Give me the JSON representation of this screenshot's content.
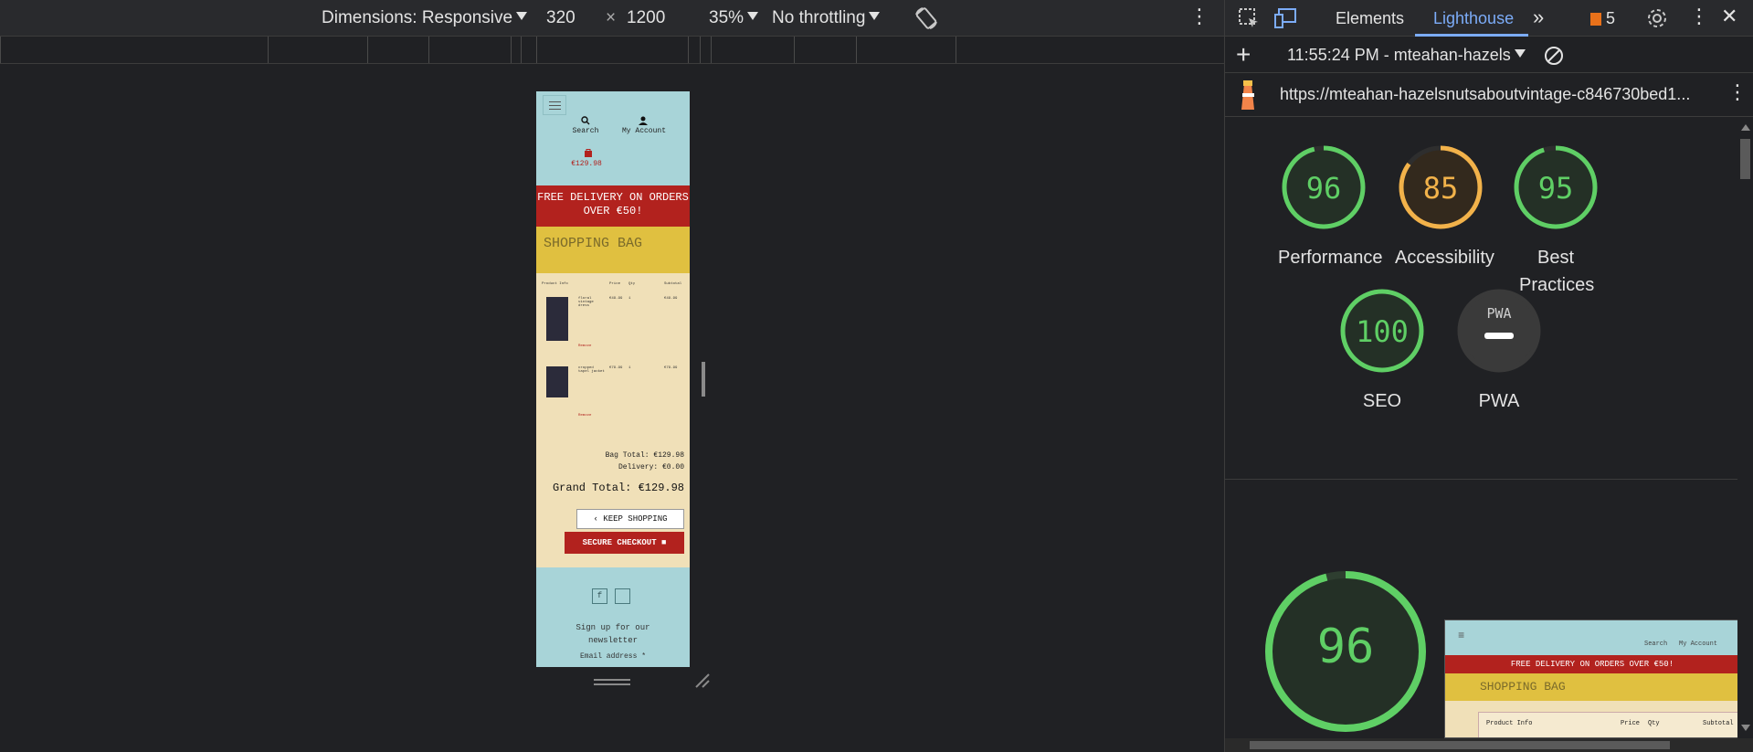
{
  "device_toolbar": {
    "dimensions_label": "Dimensions: Responsive",
    "width": "320",
    "times": "×",
    "height": "1200",
    "zoom": "35%",
    "throttling": "No throttling",
    "more": "⋮"
  },
  "site": {
    "nav": {
      "search": "Search",
      "account": "My Account",
      "bag_total": "€129.98"
    },
    "banner": "FREE DELIVERY ON ORDERS OVER €50!",
    "page_title": "SHOPPING BAG",
    "table_headers": [
      "Product Info",
      "Price",
      "Qty",
      "Subtotal"
    ],
    "items": [
      {
        "name": "floral vintage dress",
        "price": "€49.99",
        "qty": "1",
        "subtotal": "€49.99",
        "remove": "Remove"
      },
      {
        "name": "cropped tapel jacket",
        "price": "€79.99",
        "qty": "1",
        "subtotal": "€79.99",
        "remove": "Remove"
      }
    ],
    "bag_total": "Bag Total: €129.98",
    "delivery": "Delivery: €0.00",
    "grand_total": "Grand Total: €129.98",
    "keep_shopping": "KEEP SHOPPING",
    "secure_checkout": "SECURE CHECKOUT",
    "footer": {
      "newsletter": "Sign up for our newsletter",
      "email_placeholder": "Email address *"
    }
  },
  "devtools": {
    "tabs": [
      "Elements",
      "Lighthouse"
    ],
    "active_tab": "Lighthouse",
    "issues_count": "5",
    "report_label": "11:55:24 PM - mteahan-hazels",
    "url": "https://mteahan-hazelsnutsaboutvintage-c846730bed1...",
    "scores": [
      {
        "label": "Performance",
        "value": "96",
        "color": "#5fcf65"
      },
      {
        "label": "Accessibility",
        "value": "85",
        "color": "#f2b24a"
      },
      {
        "label": "Best Practices",
        "value": "95",
        "color": "#5fcf65"
      },
      {
        "label": "SEO",
        "value": "100",
        "color": "#5fcf65"
      },
      {
        "label": "PWA",
        "value": "",
        "color": "#9aa0a6"
      }
    ],
    "pwa_badge": "PWA",
    "big_score": "96",
    "preview": {
      "search": "Search",
      "account": "My Account",
      "banner": "FREE DELIVERY ON ORDERS OVER €50!",
      "title": "SHOPPING BAG",
      "headers": [
        "Product Info",
        "Price",
        "Qty",
        "Subtotal"
      ]
    }
  }
}
